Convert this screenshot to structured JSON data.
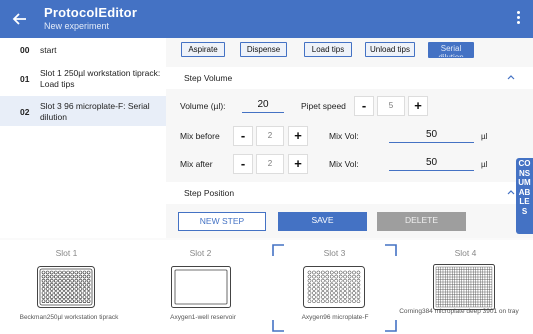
{
  "appbar": {
    "title": "ProtocolEditor",
    "subtitle": "New experiment",
    "back_icon": "arrow-left-icon",
    "menu_icon": "more-vert-icon"
  },
  "steps": [
    {
      "num": "00",
      "label": "start"
    },
    {
      "num": "01",
      "label": "Slot 1 250µl workstation tiprack: Load tips"
    },
    {
      "num": "02",
      "label": "Slot 3 96 microplate-F: Serial dilution"
    }
  ],
  "tabs": [
    "Aspirate",
    "Dispense",
    "Load tips",
    "Unload tips",
    "Serial dilution"
  ],
  "step_volume": {
    "header": "Step Volume",
    "volume_label": "Volume (µl):",
    "volume_value": "20",
    "pipet_speed_label": "Pipet speed",
    "pipet_speed_value": "5",
    "mix_before_label": "Mix before",
    "mix_before_value": "2",
    "mix_after_label": "Mix after",
    "mix_after_value": "2",
    "mix_vol_label": "Mix Vol:",
    "mix_vol_before": "50",
    "mix_vol_after": "50",
    "unit": "µl",
    "minus": "-",
    "plus": "+"
  },
  "step_position": {
    "header": "Step Position"
  },
  "actions": {
    "new_step": "NEW STEP",
    "save": "SAVE",
    "delete": "DELETE"
  },
  "consumables_label": [
    "CO",
    "NS",
    "UM",
    "AB",
    "LE",
    "S"
  ],
  "deck": [
    {
      "slot": "Slot 1",
      "labware": "Beckman250µl workstation tiprack"
    },
    {
      "slot": "Slot 2",
      "labware": "Axygen1-well reservoir"
    },
    {
      "slot": "Slot 3",
      "labware": "Axygen96 microplate-F"
    },
    {
      "slot": "Slot 4",
      "labware": "Corning384 microplate deep 3901 on tray"
    }
  ],
  "colors": {
    "primary": "#4472c4",
    "disabled": "#9e9e9e"
  }
}
